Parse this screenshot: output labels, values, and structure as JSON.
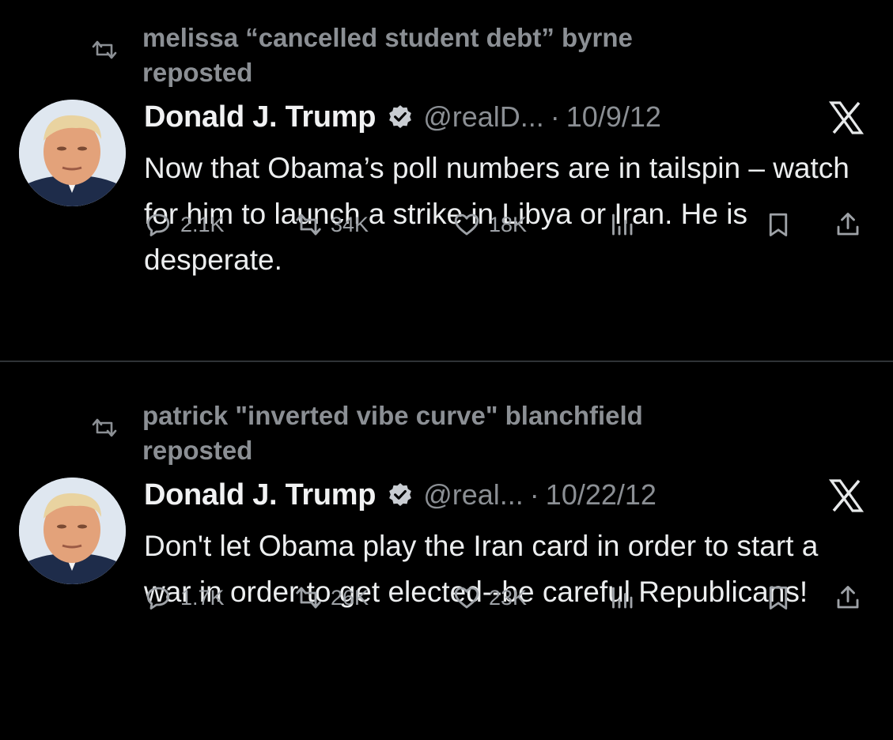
{
  "tweets": [
    {
      "reposted_by": "melissa “cancelled student debt” byrne reposted",
      "author_name": "Donald J. Trump",
      "handle": "@realD...",
      "separator": "·",
      "date": "10/9/12",
      "text": "Now that Obama’s poll numbers are in tailspin – watch for him to launch a strike in Libya or Iran.  He is desperate.",
      "replies": "2.1K",
      "reposts": "34K",
      "likes": "18K"
    },
    {
      "reposted_by": "patrick \"inverted vibe curve\" blanchfield reposted",
      "author_name": "Donald J. Trump",
      "handle": "@real...",
      "separator": "·",
      "date": "10/22/12",
      "text": "Don't let Obama play the Iran card in order to start a war in order to get elected--be careful Republicans!",
      "replies": "1.7K",
      "reposts": "26K",
      "likes": "23K"
    }
  ],
  "colors": {
    "background": "#000000",
    "text": "#e7e9ea",
    "muted": "#8b8f94",
    "verified_badge": "#c9cdd2",
    "divider": "#2f3336"
  },
  "icons": {
    "repost": "repost-icon",
    "verified": "verified-badge-icon",
    "platform": "x-logo-icon",
    "reply": "reply-icon",
    "retweet": "retweet-icon",
    "like": "heart-icon",
    "views": "views-icon",
    "bookmark": "bookmark-icon",
    "share": "share-icon"
  }
}
